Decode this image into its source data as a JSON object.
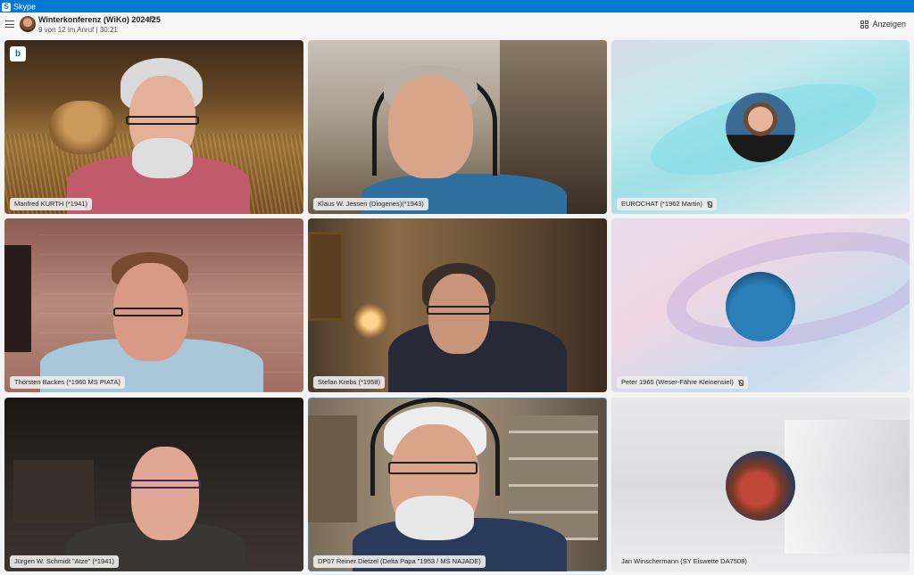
{
  "window": {
    "app_title": "Skype",
    "app_icon": "skype-icon"
  },
  "header": {
    "title": "Winterkonferenz (WiKo) 2024/25",
    "status": "9 von 12 im Anruf | 30:21",
    "view_label": "Anzeigen",
    "menu_icon": "hamburger-menu-icon",
    "settings_icon": "gear-icon",
    "view_icon": "grid-icon"
  },
  "participants": [
    {
      "name": "Manfred KURTH (*1941)",
      "muted": false,
      "video": true
    },
    {
      "name": "Klaus W. Jessen (Diogenes)(*1943)",
      "muted": false,
      "video": true
    },
    {
      "name": "EUROCHAT (*1962 Martin)",
      "muted": true,
      "video": false
    },
    {
      "name": "Thorsten Backes (*1960 MS PIATA)",
      "muted": false,
      "video": true
    },
    {
      "name": "Stefan Krebs (*1958)",
      "muted": false,
      "video": true
    },
    {
      "name": "Peter 1965 (Weser-Fähre Kleinensiel)",
      "muted": true,
      "video": false
    },
    {
      "name": "Jürgen W. Schmidt \"Atze\" (*1941)",
      "muted": false,
      "video": true
    },
    {
      "name": "DP07 Reiner Dietzel (Delta Papa \"1953 / MS NAJADE)",
      "muted": false,
      "video": true,
      "active_speaker": true
    },
    {
      "name": "Jan Winschermann (SY Eiswette DA7508)",
      "muted": false,
      "video": false
    }
  ],
  "colors": {
    "titlebar": "#0078d4",
    "active_outline": "#4a90c8"
  }
}
